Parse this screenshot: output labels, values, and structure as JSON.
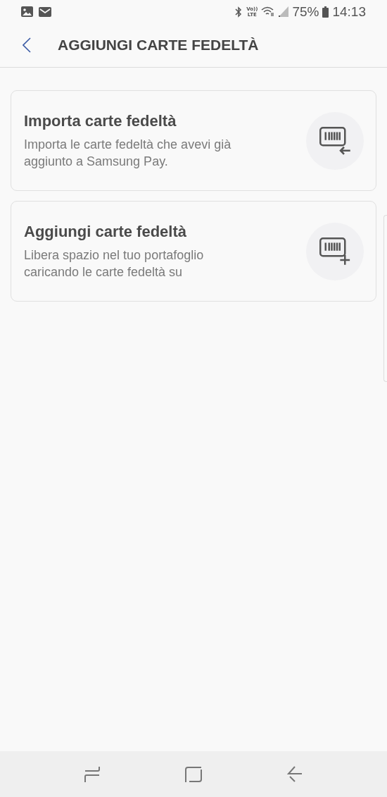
{
  "status_bar": {
    "volte": [
      "Vo))",
      "LTE"
    ],
    "battery": "75%",
    "time": "14:13"
  },
  "header": {
    "title": "AGGIUNGI CARTE FEDELTÀ"
  },
  "options": [
    {
      "kind": "import",
      "title": "Importa carte fedeltà",
      "lines": [
        "Importa le carte fedeltà che avevi già",
        "aggiunto a Samsung Pay."
      ]
    },
    {
      "kind": "add",
      "title": "Aggiungi carte fedeltà",
      "lines": [
        "Libera spazio nel tuo portafoglio",
        "caricando le carte fedeltà su"
      ]
    }
  ]
}
